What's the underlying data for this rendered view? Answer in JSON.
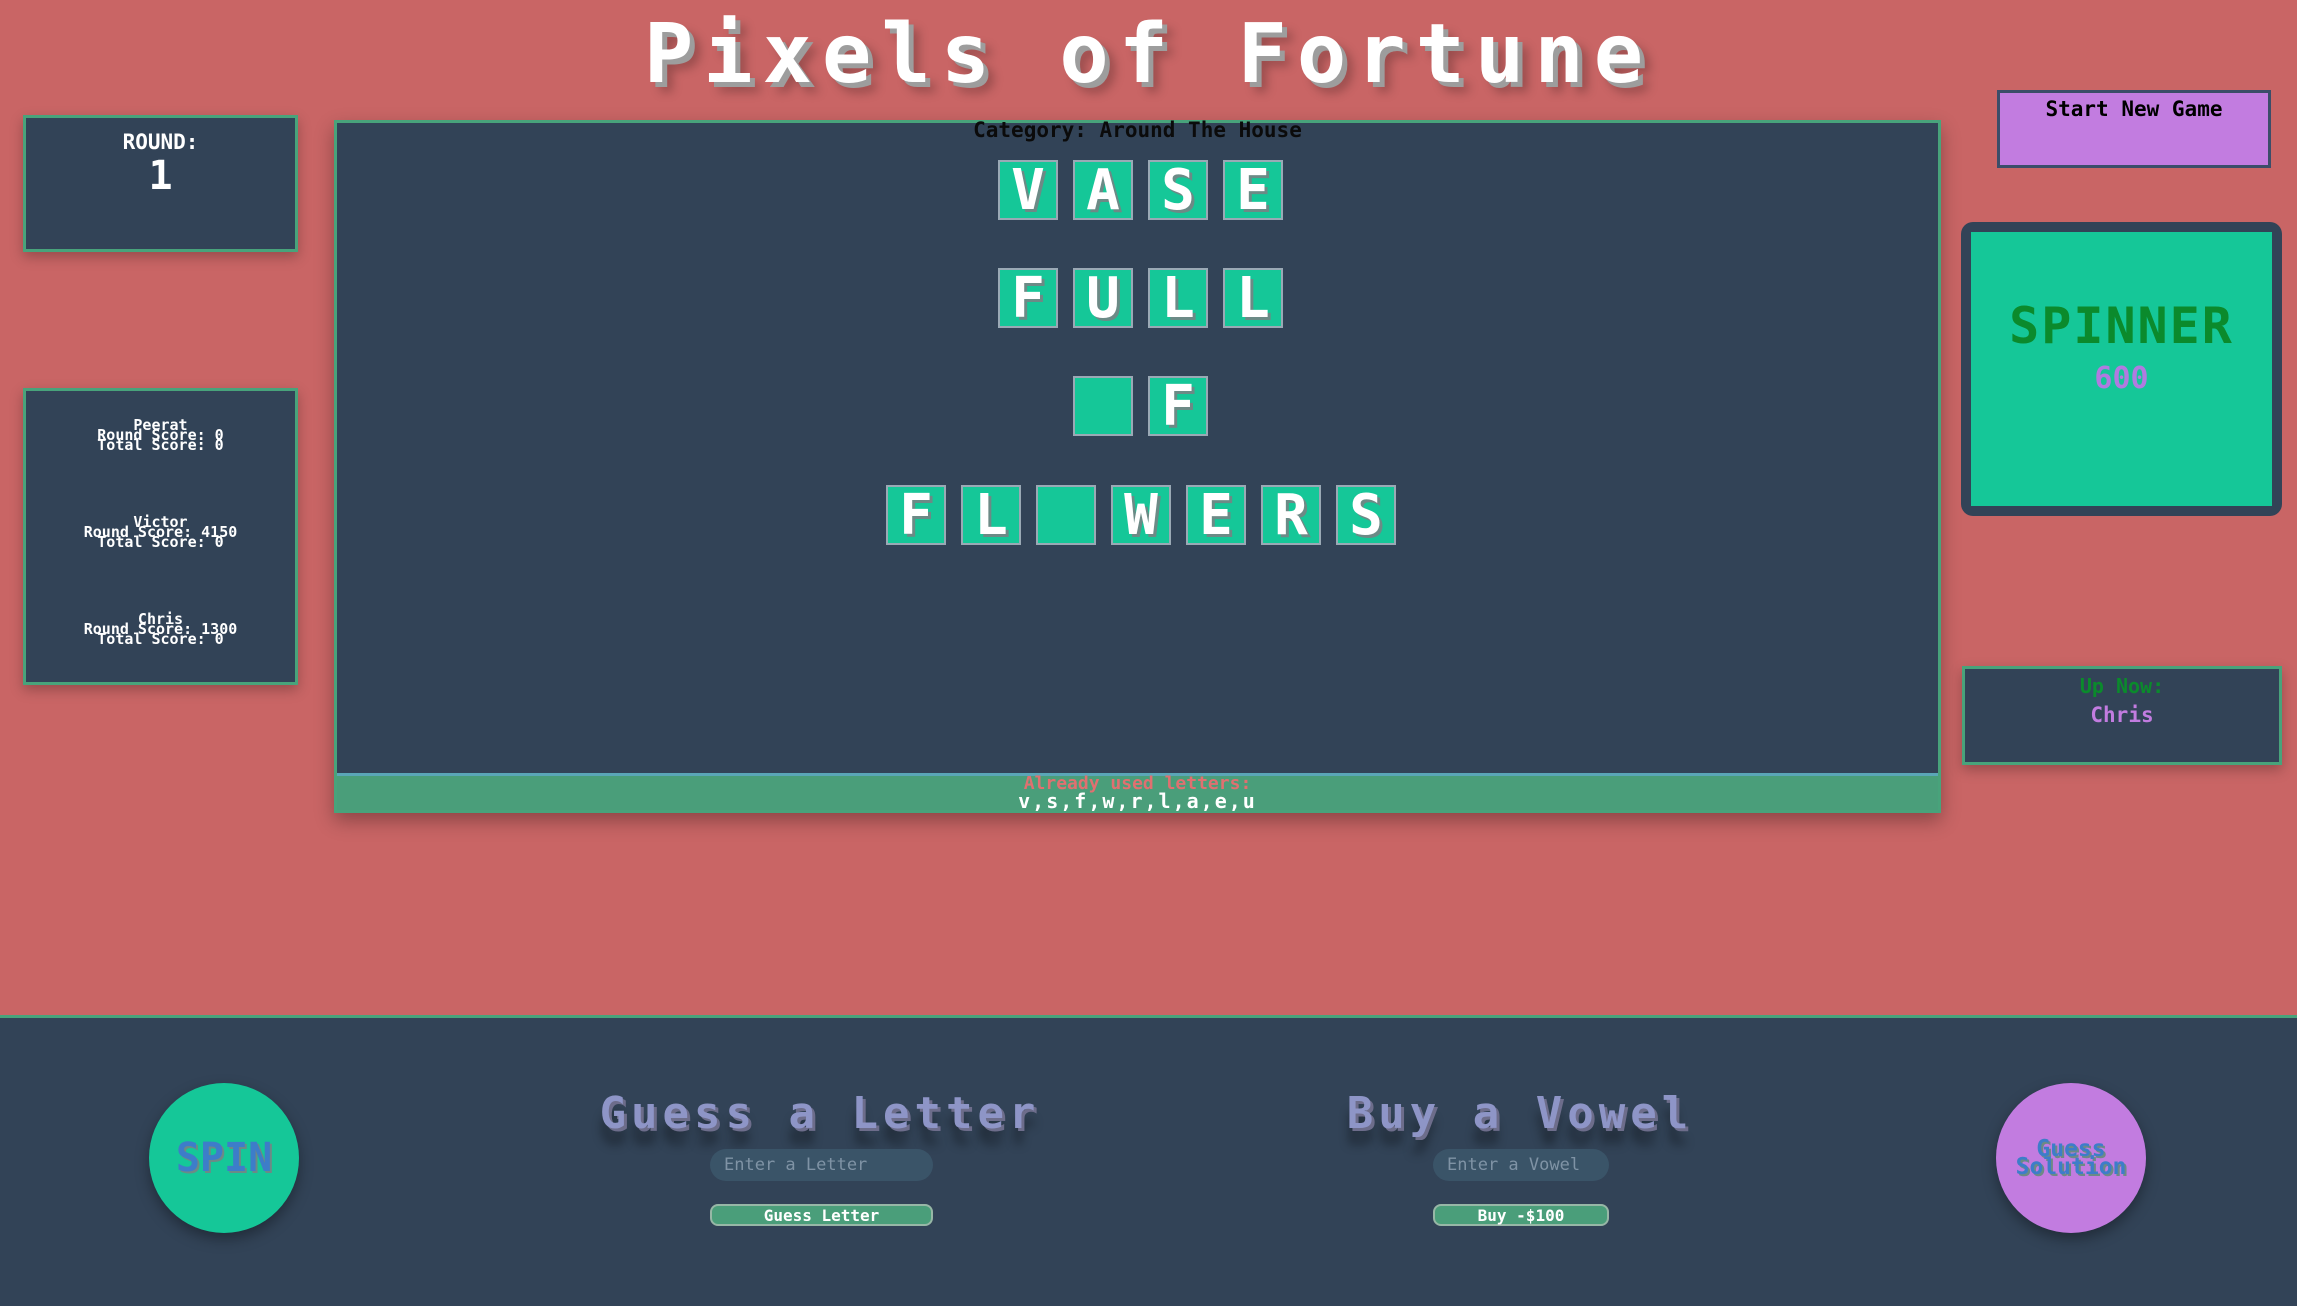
{
  "header": {
    "title": "Pixels of Fortune"
  },
  "round": {
    "label": "ROUND:",
    "value": "1"
  },
  "players": [
    {
      "name": "Peerat",
      "round_score_text": "Round Score: 0",
      "total_score_text": "Total Score: 0"
    },
    {
      "name": "Victor",
      "round_score_text": "Round Score: 4150",
      "total_score_text": "Total Score: 0"
    },
    {
      "name": "Chris",
      "round_score_text": "Round Score: 1300",
      "total_score_text": "Total Score: 0"
    }
  ],
  "board": {
    "category": "Category: Around The House",
    "rows": [
      [
        "V",
        "A",
        "S",
        "E"
      ],
      [
        "F",
        "U",
        "L",
        "L"
      ],
      [
        "",
        "F"
      ],
      [
        "F",
        "L",
        "",
        "W",
        "E",
        "R",
        "S"
      ]
    ],
    "used_letters_label": "Already used letters:",
    "used_letters": "v,s,f,w,r,l,a,e,u"
  },
  "controls": {
    "new_game_label": "Start New Game",
    "spin_label": "SPIN",
    "guess_solution_label": "Guess Solution",
    "guess_letter_title": "Guess a Letter",
    "guess_letter_placeholder": "Enter a Letter",
    "guess_letter_button": "Guess Letter",
    "buy_vowel_title": "Buy a Vowel",
    "buy_vowel_placeholder": "Enter a Vowel",
    "buy_vowel_button": "Buy -$100"
  },
  "spinner": {
    "label": "SPINNER",
    "value": "600"
  },
  "up_now": {
    "label": "Up Now:",
    "name": "Chris"
  },
  "colors": {
    "background": "#c96565",
    "panel": "#324357",
    "accent_green": "#15c798",
    "accent_purple": "#c27ce0"
  }
}
